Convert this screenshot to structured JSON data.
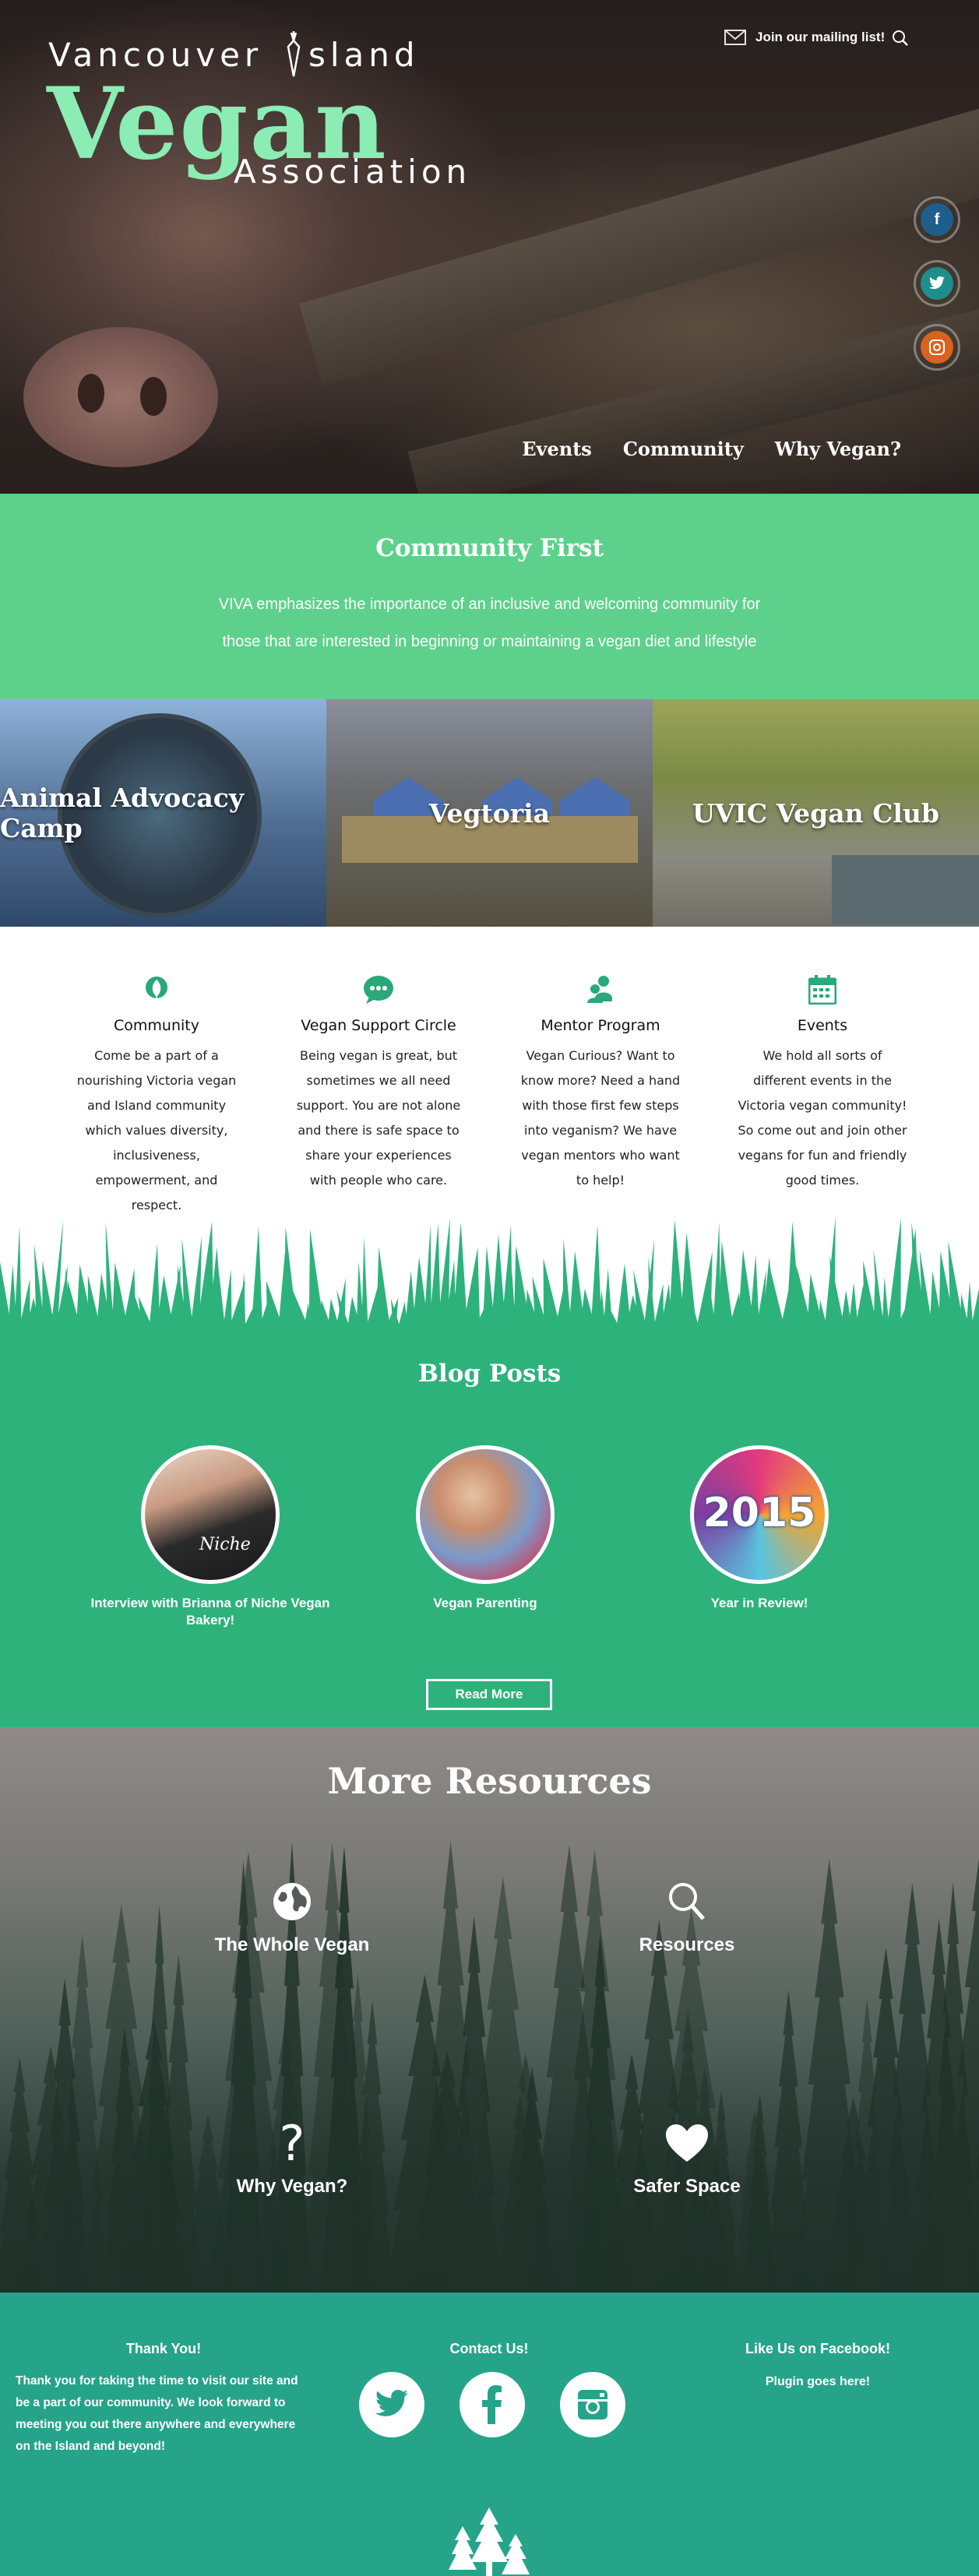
{
  "header": {
    "logo": {
      "line1": "Vancouver",
      "line1b": "sland",
      "word": "Vegan",
      "line3": "Association"
    },
    "mailing_label": "Join our mailing list!",
    "nav": [
      "Events",
      "Community",
      "Why Vegan?"
    ],
    "social": [
      {
        "icon": "facebook-icon",
        "glyph": "f",
        "color": "#1f5e8c"
      },
      {
        "icon": "twitter-icon",
        "glyph": "t",
        "color": "#1e8e8a"
      },
      {
        "icon": "instagram-icon",
        "glyph": "◎",
        "color": "#d9621f"
      }
    ]
  },
  "community_first": {
    "title": "Community First",
    "text": "VIVA emphasizes the importance of an inclusive and welcoming community for those that are interested in beginning or maintaining a vegan diet and lifestyle"
  },
  "tiles": [
    {
      "label": "Animal Advocacy Camp"
    },
    {
      "label": "Vegtoria"
    },
    {
      "label": "UVIC Vegan Club"
    }
  ],
  "features": [
    {
      "icon": "leaf-icon",
      "title": "Community",
      "text": "Come be a part of a nourishing Victoria vegan and Island community which values diversity, inclusiveness, empowerment, and respect."
    },
    {
      "icon": "chat-bubble-icon",
      "title": "Vegan Support Circle",
      "text": "Being vegan is great, but sometimes we all need support. You are not alone and there is safe space to share your experiences with people who care."
    },
    {
      "icon": "people-icon",
      "title": "Mentor Program",
      "text": "Vegan Curious? Want to know more? Need a hand with those first few steps into veganism? We have vegan mentors who want to help!"
    },
    {
      "icon": "calendar-icon",
      "title": "Events",
      "text": "We hold all sorts of different events in the Victoria vegan community! So come out and join other vegans for fun and friendly good times."
    }
  ],
  "blog": {
    "title": "Blog Posts",
    "posts": [
      {
        "title": "Interview with Brianna of Niche Vegan Bakery!",
        "image_text": "Niche"
      },
      {
        "title": "Vegan Parenting"
      },
      {
        "title": "Year in Review!",
        "image_text": "2015"
      }
    ],
    "read_more": "Read More"
  },
  "resources": {
    "title": "More Resources",
    "items": [
      {
        "icon": "globe-icon",
        "label": "The Whole Vegan"
      },
      {
        "icon": "search-icon",
        "label": "Resources"
      },
      {
        "icon": "question-mark-icon",
        "label": "Why Vegan?",
        "glyph": "?"
      },
      {
        "icon": "heart-icon",
        "label": "Safer Space"
      }
    ]
  },
  "footer": {
    "thanks_title": "Thank You!",
    "thanks_text": "Thank you for taking the time to visit our site and be a part of our community. We look forward to meeting you out there anywhere and everywhere on the Island and beyond!",
    "contact_title": "Contact Us!",
    "facebook_title": "Like Us on Facebook!",
    "plugin_text": "Plugin goes here!",
    "social": [
      "twitter-icon",
      "facebook-icon",
      "instagram-icon"
    ]
  },
  "colors": {
    "green": "#5dd18b",
    "blog_green": "#2db27b",
    "footer_teal": "#25a48a",
    "logo_green": "#8bedb3"
  }
}
